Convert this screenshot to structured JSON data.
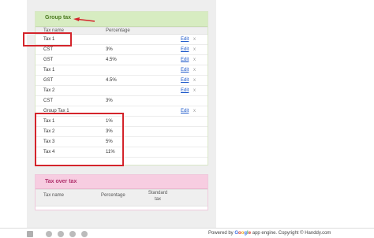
{
  "group_panel": {
    "title": "Group tax",
    "columns": [
      "Tax name",
      "Percentage"
    ],
    "rows": [
      {
        "name": "Tax 1",
        "pct": "",
        "edit": "Edit",
        "x": "x"
      },
      {
        "name": "CST",
        "pct": "3%",
        "edit": "Edit",
        "x": "x"
      },
      {
        "name": "GST",
        "pct": "4.5%",
        "edit": "Edit",
        "x": "x"
      },
      {
        "name": "Tax 1",
        "pct": "",
        "edit": "Edit",
        "x": "x"
      },
      {
        "name": "GST",
        "pct": "4.5%",
        "edit": "Edit",
        "x": "x"
      },
      {
        "name": "Tax 2",
        "pct": "",
        "edit": "Edit",
        "x": "x"
      },
      {
        "name": "CST",
        "pct": "3%",
        "edit": "",
        "x": ""
      },
      {
        "name": "Group Tax 1",
        "pct": "",
        "edit": "Edit",
        "x": "x"
      },
      {
        "name": "Tax 1",
        "pct": "1%",
        "edit": "",
        "x": ""
      },
      {
        "name": "Tax 2",
        "pct": "3%",
        "edit": "",
        "x": ""
      },
      {
        "name": "Tax 3",
        "pct": "5%",
        "edit": "",
        "x": ""
      },
      {
        "name": "Tax 4",
        "pct": "11%",
        "edit": "",
        "x": ""
      }
    ]
  },
  "tax_over_tax_panel": {
    "title": "Tax over tax",
    "columns": [
      "Tax name",
      "Percentage",
      "Standard tax"
    ]
  },
  "footer": {
    "powered_prefix": "Powered by",
    "google": "Google",
    "powered_suffix": "app engine. Copyright © Handdy.com"
  },
  "colors": {
    "group_header_bg": "#d7ecc1",
    "tax_header_bg": "#f7cde1",
    "highlight": "#d4242b",
    "link": "#1a56c9"
  }
}
